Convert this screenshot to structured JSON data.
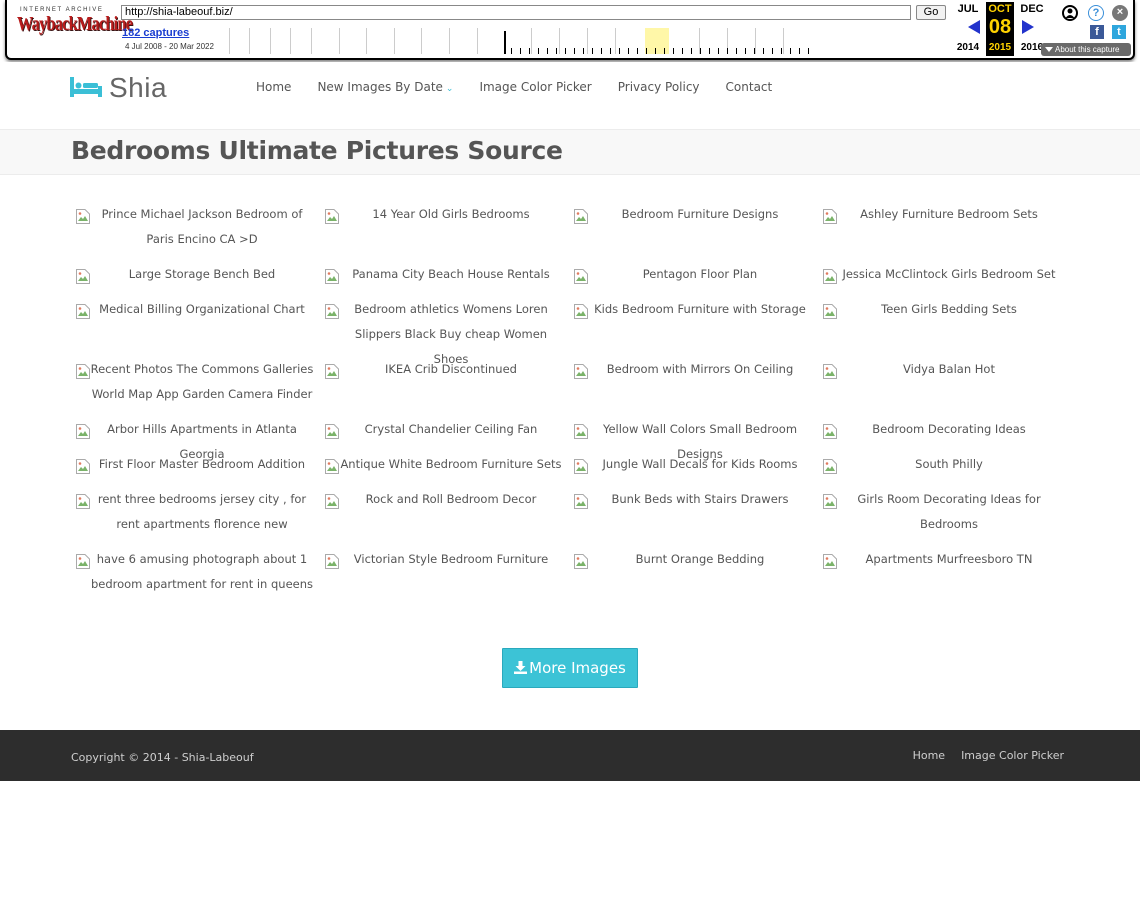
{
  "wayback": {
    "logo_top": "INTERNET ARCHIVE",
    "logo_main": "WaybackMachine",
    "url": "http://shia-labeouf.biz/",
    "go_label": "Go",
    "captures": "182 captures",
    "range": "4 Jul 2008 - 20 Mar 2022",
    "prev_month": "JUL",
    "cur_month": "OCT",
    "next_month": "DEC",
    "cur_day": "08",
    "prev_year": "2014",
    "cur_year": "2015",
    "next_year": "2016",
    "about_label": "About this capture",
    "icons": [
      "user-icon",
      "help-icon",
      "close-icon",
      "facebook-icon",
      "twitter-icon"
    ]
  },
  "header": {
    "brand": "Shia",
    "brand_icon": "bed-icon",
    "nav": [
      "Home",
      "New Images By Date",
      "Image Color Picker",
      "Privacy Policy",
      "Contact"
    ]
  },
  "page": {
    "title": "Bedrooms Ultimate Pictures Source"
  },
  "grid": {
    "rows": [
      [
        "Prince Michael Jackson Bedroom of Paris Encino CA >D",
        "14 Year Old Girls Bedrooms",
        "Bedroom Furniture Designs",
        "Ashley Furniture Bedroom Sets"
      ],
      [
        "Large Storage Bench Bed",
        "Panama City Beach House Rentals",
        "Pentagon Floor Plan",
        "Jessica McClintock Girls Bedroom Set"
      ],
      [
        "Medical Billing Organizational Chart",
        "Bedroom athletics Womens Loren Slippers Black Buy cheap Women Shoes",
        "Kids Bedroom Furniture with Storage",
        "Teen Girls Bedding Sets"
      ],
      [
        "Recent Photos The Commons Galleries World Map App Garden Camera Finder",
        "IKEA Crib Discontinued",
        "Bedroom with Mirrors On Ceiling",
        "Vidya Balan Hot"
      ],
      [
        "Arbor Hills Apartments in Atlanta Georgia",
        "Crystal Chandelier Ceiling Fan",
        "Yellow Wall Colors Small Bedroom Designs",
        "Bedroom Decorating Ideas"
      ],
      [
        "First Floor Master Bedroom Addition",
        "Antique White Bedroom Furniture Sets",
        "Jungle Wall Decals for Kids Rooms",
        "South Philly"
      ],
      [
        "rent three bedrooms jersey city , for rent apartments florence new",
        "Rock and Roll Bedroom Decor",
        "Bunk Beds with Stairs Drawers",
        "Girls Room Decorating Ideas for Bedrooms"
      ],
      [
        "have 6 amusing photograph about 1 bedroom apartment for rent in queens",
        "Victorian Style Bedroom Furniture",
        "Burnt Orange Bedding",
        "Apartments Murfreesboro TN"
      ]
    ]
  },
  "more_button": "More Images",
  "footer": {
    "copyright": "Copyright © 2014 - Shia-Labeouf",
    "links": [
      "Home",
      "Image Color Picker"
    ]
  },
  "colors": {
    "accent": "#3cc3d6",
    "footer_bg": "#2d2d2d",
    "wayback_red": "#b81c1c",
    "wayback_yellow": "#ffd200"
  }
}
